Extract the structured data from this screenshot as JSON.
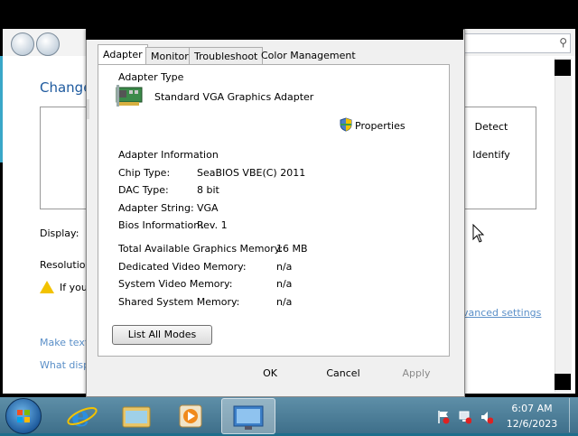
{
  "background": {
    "heading": "Change",
    "display_label": "Display:",
    "resolution_label": "Resolutio",
    "warning_text": "If you",
    "detect_label": "Detect",
    "identify_label": "Identify",
    "link_make_text": "Make text",
    "link_what_disp": "What disp",
    "advanced_settings": "vanced settings"
  },
  "dialog": {
    "tabs": [
      "Adapter",
      "Monitor",
      "Troubleshoot",
      "Color Management"
    ],
    "adapter_type_heading": "Adapter Type",
    "adapter_name": "Standard VGA Graphics Adapter",
    "properties_label": "Properties",
    "adapter_info_heading": "Adapter Information",
    "info": [
      {
        "label": "Chip Type:",
        "value": "SeaBIOS VBE(C) 2011"
      },
      {
        "label": "DAC Type:",
        "value": "8 bit"
      },
      {
        "label": "Adapter String:",
        "value": "VGA"
      },
      {
        "label": "Bios Information:",
        "value": "Rev. 1"
      }
    ],
    "memory": [
      {
        "label": "Total Available Graphics Memory:",
        "value": "16 MB"
      },
      {
        "label": "Dedicated Video Memory:",
        "value": "n/a"
      },
      {
        "label": "System Video Memory:",
        "value": "n/a"
      },
      {
        "label": "Shared System Memory:",
        "value": "n/a"
      }
    ],
    "list_all_modes": "List All Modes",
    "ok": "OK",
    "cancel": "Cancel",
    "apply": "Apply"
  },
  "taskbar": {
    "time": "6:07 AM",
    "date": "12/6/2023"
  }
}
